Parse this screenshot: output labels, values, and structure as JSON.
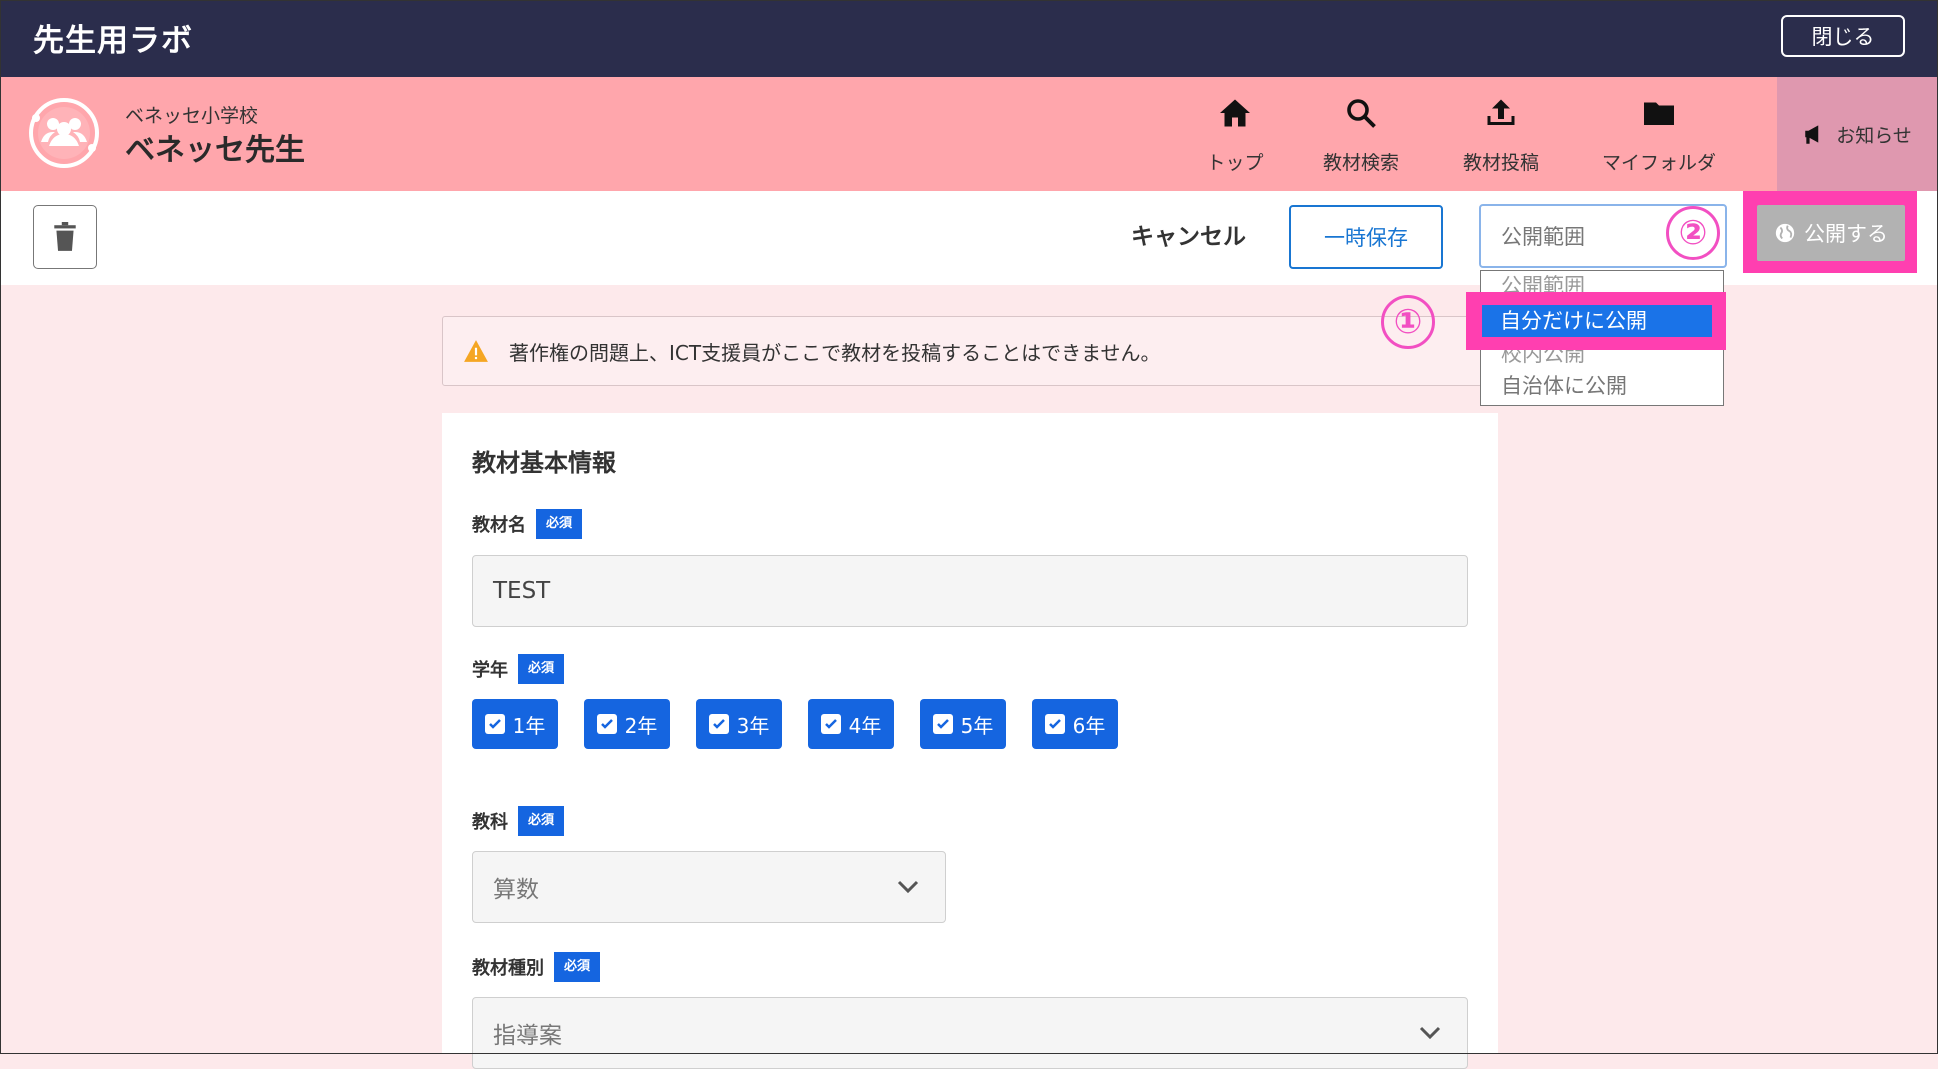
{
  "topbar": {
    "app_title": "先生用ラボ",
    "close_label": "閉じる"
  },
  "header": {
    "school_name": "ベネッセ小学校",
    "user_name": "ベネッセ先生",
    "nav": [
      {
        "label": "トップ",
        "icon": "home-icon"
      },
      {
        "label": "教材検索",
        "icon": "search-icon"
      },
      {
        "label": "教材投稿",
        "icon": "upload-icon"
      },
      {
        "label": "マイフォルダ",
        "icon": "folder-icon"
      }
    ],
    "notice_label": "お知らせ"
  },
  "toolbar": {
    "cancel_label": "キャンセル",
    "save_label": "一時保存",
    "scope_placeholder": "公開範囲",
    "publish_label": "公開する"
  },
  "dropdown": {
    "options": [
      "公開範囲",
      "自分だけに公開",
      "校内公開",
      "自治体に公開"
    ],
    "selected": "自分だけに公開"
  },
  "markers": {
    "one": "①",
    "two": "②"
  },
  "warning": {
    "text": "著作権の問題上、ICT支援員がここで教材を投稿することはできません。"
  },
  "form": {
    "section_title": "教材基本情報",
    "required_badge": "必須",
    "name_label": "教材名",
    "name_value": "TEST",
    "grade_label": "学年",
    "grades": [
      "1年",
      "2年",
      "3年",
      "4年",
      "5年",
      "6年"
    ],
    "subject_label": "教科",
    "subject_value": "算数",
    "type_label": "教材種別",
    "type_value": "指導案"
  },
  "colors": {
    "topbar": "#2b2d4c",
    "header": "#ffa6ac",
    "accent": "#1565e0",
    "highlight": "#ff3fb0"
  }
}
